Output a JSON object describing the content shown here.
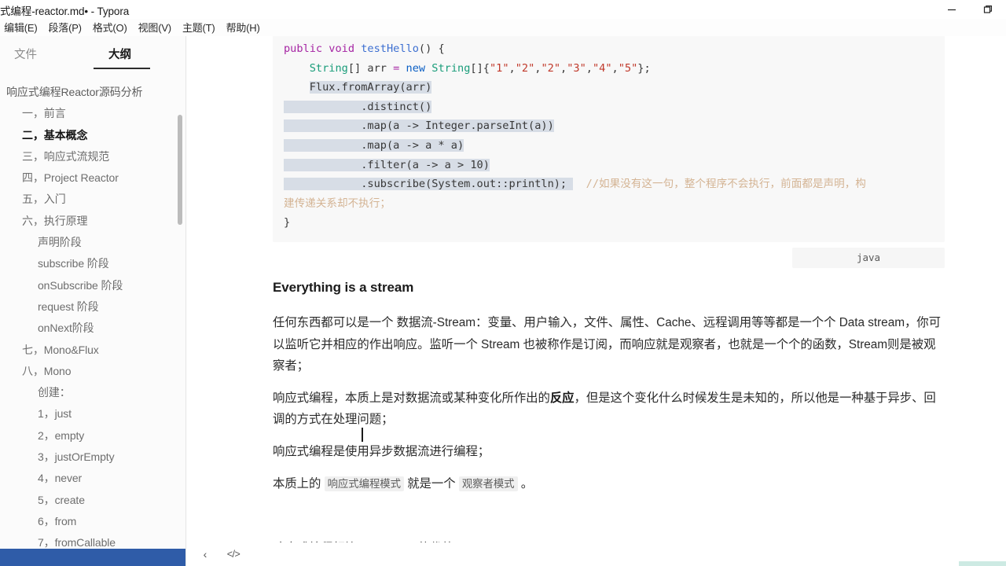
{
  "window": {
    "title": "式编程-reactor.md• - Typora",
    "controls": [
      {
        "name": "minimize",
        "glyph": "minimize-icon"
      },
      {
        "name": "maximize",
        "glyph": "maximize-icon"
      }
    ]
  },
  "menubar": {
    "items": [
      {
        "label": ")",
        "name": "file-menu-clipped"
      },
      {
        "label": "编辑(E)",
        "name": "edit-menu"
      },
      {
        "label": "段落(P)",
        "name": "paragraph-menu"
      },
      {
        "label": "格式(O)",
        "name": "format-menu"
      },
      {
        "label": "视图(V)",
        "name": "view-menu"
      },
      {
        "label": "主题(T)",
        "name": "theme-menu"
      },
      {
        "label": "帮助(H)",
        "name": "help-menu"
      }
    ]
  },
  "sidebar": {
    "tabs": [
      {
        "label": "文件",
        "name": "tab-files",
        "active": false
      },
      {
        "label": "大纲",
        "name": "tab-outline",
        "active": true
      }
    ],
    "outline": [
      {
        "label": "响应式编程Reactor源码分析",
        "level": 1,
        "active": false
      },
      {
        "label": "一，前言",
        "level": 2,
        "active": false
      },
      {
        "label": "二，基本概念",
        "level": 2,
        "active": true
      },
      {
        "label": "三，响应式流规范",
        "level": 2,
        "active": false
      },
      {
        "label": "四，Project Reactor",
        "level": 2,
        "active": false
      },
      {
        "label": "五，入门",
        "level": 2,
        "active": false
      },
      {
        "label": "六，执行原理",
        "level": 2,
        "active": false
      },
      {
        "label": "声明阶段",
        "level": 3,
        "active": false
      },
      {
        "label": "subscribe 阶段",
        "level": 3,
        "active": false
      },
      {
        "label": "onSubscribe 阶段",
        "level": 3,
        "active": false
      },
      {
        "label": "request 阶段",
        "level": 3,
        "active": false
      },
      {
        "label": "onNext阶段",
        "level": 3,
        "active": false
      },
      {
        "label": "七，Mono&Flux",
        "level": 2,
        "active": false
      },
      {
        "label": "八，Mono",
        "level": 2,
        "active": false
      },
      {
        "label": "创建：",
        "level": 3,
        "active": false
      },
      {
        "label": "1，just",
        "level": 4,
        "active": false
      },
      {
        "label": "2，empty",
        "level": 4,
        "active": false
      },
      {
        "label": "3，justOrEmpty",
        "level": 4,
        "active": false
      },
      {
        "label": "4，never",
        "level": 4,
        "active": false
      },
      {
        "label": "5，create",
        "level": 4,
        "active": false
      },
      {
        "label": "6，from",
        "level": 4,
        "active": false
      },
      {
        "label": "7，fromCallable",
        "level": 4,
        "active": false
      }
    ]
  },
  "document": {
    "code_lang_label": "java",
    "code_lines": [
      [
        {
          "t": "public",
          "c": "kw"
        },
        {
          "t": " ",
          "c": ""
        },
        {
          "t": "void",
          "c": "kw"
        },
        {
          "t": " ",
          "c": ""
        },
        {
          "t": "testHello",
          "c": "fn"
        },
        {
          "t": "() {",
          "c": "punc"
        }
      ],
      [
        {
          "t": "    ",
          "c": ""
        },
        {
          "t": "String",
          "c": "type"
        },
        {
          "t": "[] ",
          "c": "punc"
        },
        {
          "t": "arr",
          "c": "punc"
        },
        {
          "t": " ",
          "c": ""
        },
        {
          "t": "=",
          "c": "op"
        },
        {
          "t": " ",
          "c": ""
        },
        {
          "t": "new",
          "c": "kw2"
        },
        {
          "t": " ",
          "c": ""
        },
        {
          "t": "String",
          "c": "type"
        },
        {
          "t": "[]{",
          "c": "punc"
        },
        {
          "t": "\"1\"",
          "c": "str"
        },
        {
          "t": ",",
          "c": "punc"
        },
        {
          "t": "\"2\"",
          "c": "str"
        },
        {
          "t": ",",
          "c": "punc"
        },
        {
          "t": "\"2\"",
          "c": "str"
        },
        {
          "t": ",",
          "c": "punc"
        },
        {
          "t": "\"3\"",
          "c": "str"
        },
        {
          "t": ",",
          "c": "punc"
        },
        {
          "t": "\"4\"",
          "c": "str"
        },
        {
          "t": ",",
          "c": "punc"
        },
        {
          "t": "\"5\"",
          "c": "str"
        },
        {
          "t": "};",
          "c": "punc"
        }
      ],
      [
        {
          "t": "    ",
          "c": ""
        },
        {
          "t": "Flux.fromArray(arr)",
          "c": "punc",
          "sel": true
        }
      ],
      [
        {
          "t": "    ",
          "c": "",
          "sel": true
        },
        {
          "t": "        .distinct()",
          "c": "punc",
          "sel": true
        }
      ],
      [
        {
          "t": "    ",
          "c": "",
          "sel": true
        },
        {
          "t": "        .map(a -> Integer.parseInt(a))",
          "c": "punc",
          "sel": true
        }
      ],
      [
        {
          "t": "    ",
          "c": "",
          "sel": true
        },
        {
          "t": "        .map(a -> a * a)",
          "c": "punc",
          "sel": true
        }
      ],
      [
        {
          "t": "    ",
          "c": "",
          "sel": true
        },
        {
          "t": "        .filter(a -> a > 10)",
          "c": "punc",
          "sel": true
        }
      ],
      [
        {
          "t": "    ",
          "c": "",
          "sel": true
        },
        {
          "t": "        .subscribe(System.out::println); ",
          "c": "punc",
          "sel": true
        },
        {
          "t": "  //如果没有这一句，整个程序不会执行，前面都是声明，构",
          "c": "cmt"
        }
      ],
      [
        {
          "t": "建传递关系却不执行；",
          "c": "cmt"
        }
      ],
      [
        {
          "t": "}",
          "c": "punc"
        }
      ]
    ],
    "heading": "Everything is a stream",
    "paragraphs": [
      {
        "name": "paragraph-stream-definition",
        "html": "任何东西都可以是一个 数据流-Stream：变量、用户输入，文件、属性、Cache、远程调用等等都是一个个 Data stream，你可以监听它并相应的作出响应。监听一个 Stream 也被称作是订阅，而响应就是观察者，也就是一个个的函数，Stream则是被观察者；"
      },
      {
        "name": "paragraph-reactive-essence",
        "html": "响应式编程，本质上是对数据流或某种变化所作出的<b>反应</b>，但是这个变化什么时候发生是未知的，所以他是一种基于异步、回调的方式在处理问题；"
      },
      {
        "name": "paragraph-async-stream",
        "html": "响应式编程是使用异步数据流进行编程；"
      },
      {
        "name": "paragraph-observer-pattern",
        "html": "本质上的 <code class=\"inline\">响应式编程模式</code> 就是一个 <code class=\"inline\">观察者模式</code> 。"
      },
      {
        "name": "paragraph-advantages",
        "html": "响应式编程相比Stream API的优势："
      }
    ]
  },
  "bottombar": {
    "icons": [
      {
        "label": "‹",
        "name": "collapse-sidebar-icon"
      },
      {
        "label": "</>",
        "name": "source-code-mode-icon"
      }
    ]
  },
  "colors": {
    "accent": "#2f5ca8",
    "selection": "#d7dde6",
    "code_bg": "#f8f8f8",
    "comment": "#d4b494"
  }
}
